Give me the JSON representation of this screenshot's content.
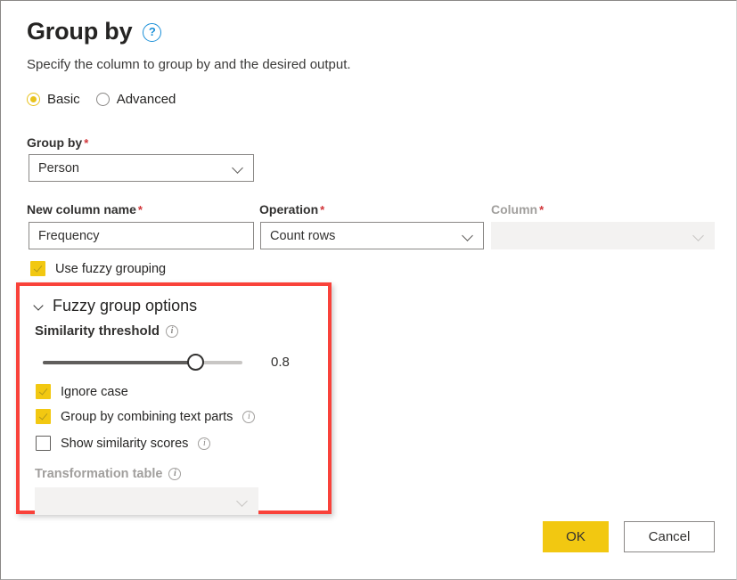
{
  "dialog": {
    "title": "Group by",
    "help_icon": "question-circle-icon",
    "subtitle": "Specify the column to group by and the desired output."
  },
  "mode": {
    "options": [
      {
        "label": "Basic",
        "selected": true
      },
      {
        "label": "Advanced",
        "selected": false
      }
    ]
  },
  "group_by": {
    "label": "Group by",
    "required_marker": "*",
    "value": "Person"
  },
  "aggregation": {
    "new_column": {
      "label": "New column name",
      "required_marker": "*",
      "value": "Frequency"
    },
    "operation": {
      "label": "Operation",
      "required_marker": "*",
      "value": "Count rows"
    },
    "column": {
      "label": "Column",
      "required_marker": "*",
      "value": "",
      "disabled": true
    }
  },
  "use_fuzzy_grouping": {
    "label": "Use fuzzy grouping",
    "checked": true
  },
  "fuzzy_options": {
    "header": "Fuzzy group options",
    "similarity_threshold": {
      "label": "Similarity threshold",
      "value": "0.8",
      "min": 0,
      "max": 1
    },
    "ignore_case": {
      "label": "Ignore case",
      "checked": true
    },
    "combine_text_parts": {
      "label": "Group by combining text parts",
      "checked": true
    },
    "show_similarity_scores": {
      "label": "Show similarity scores",
      "checked": false
    },
    "transformation_table": {
      "label": "Transformation table",
      "value": "",
      "disabled": true
    }
  },
  "footer": {
    "ok_label": "OK",
    "cancel_label": "Cancel"
  },
  "colors": {
    "accent_yellow": "#f2c811",
    "radio_yellow": "#e8c21c",
    "highlight_red": "#f9423a",
    "required_red": "#d13438",
    "help_blue": "#1a8fd8"
  }
}
